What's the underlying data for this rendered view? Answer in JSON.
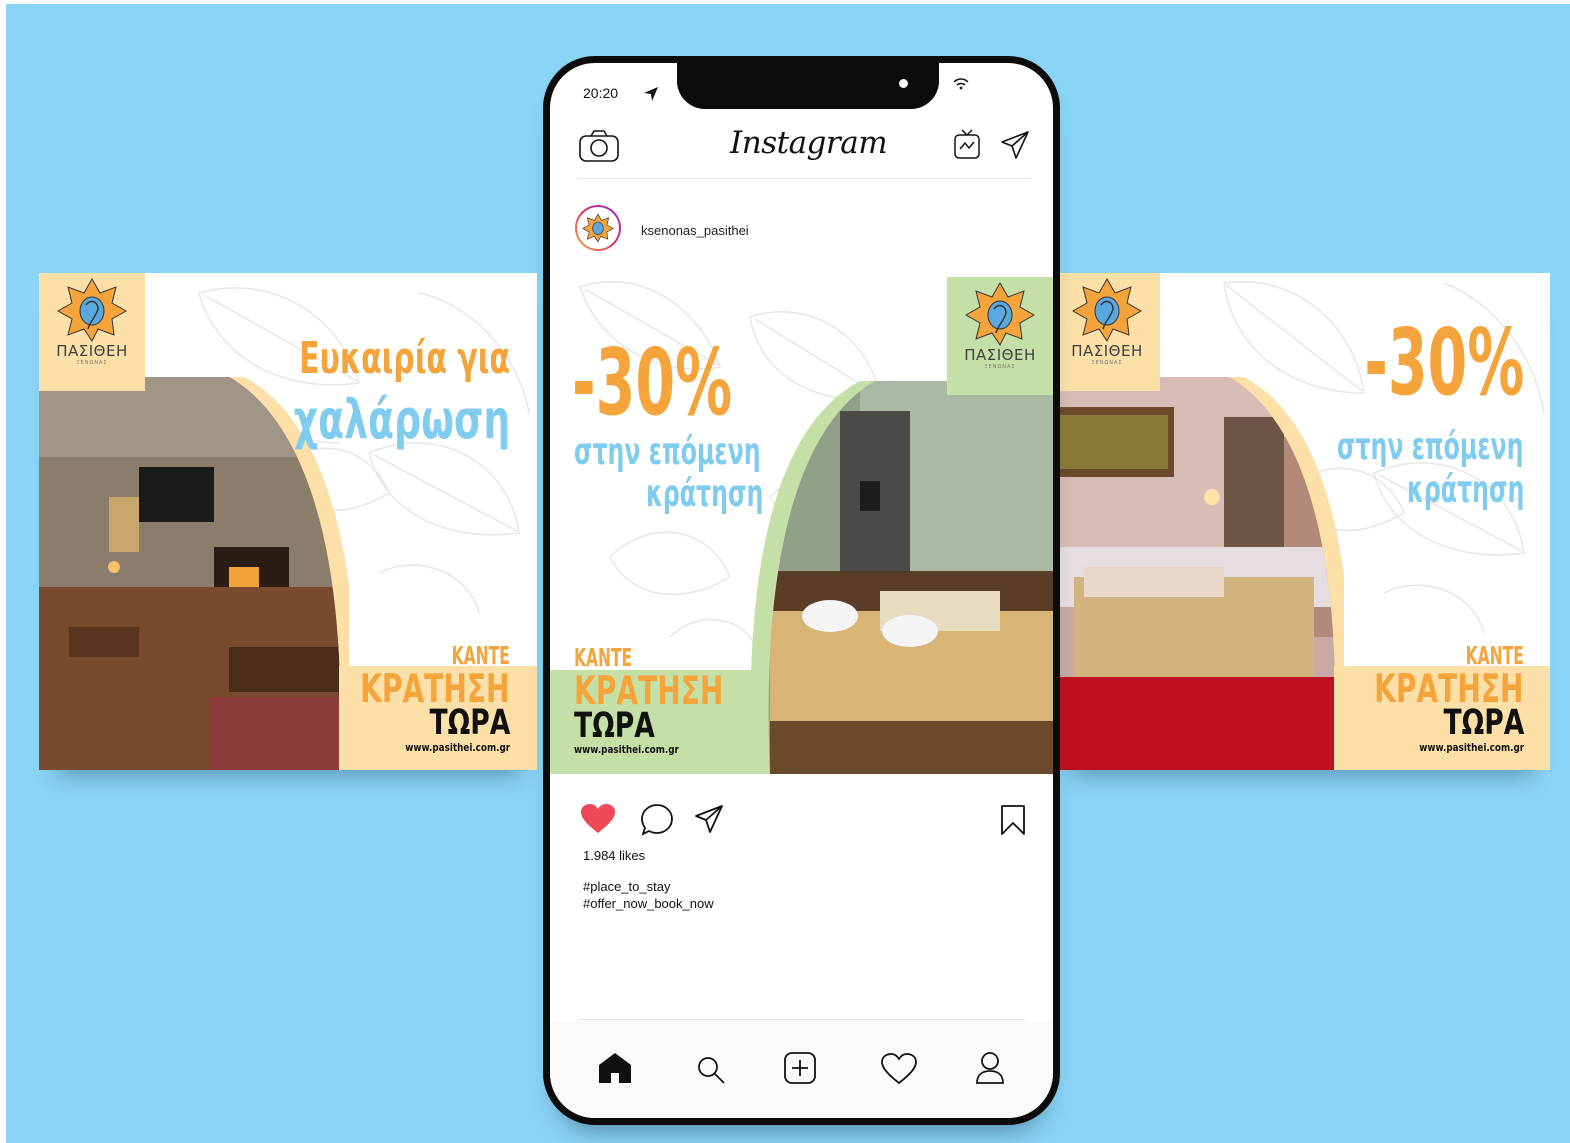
{
  "phone": {
    "status_time": "20:20",
    "app_title": "Instagram",
    "post": {
      "username": "ksenonas_pasithei",
      "likes": "1.984 likes",
      "hashtags": [
        "#place_to_stay",
        "#offer_now_book_now"
      ]
    },
    "icons": {
      "header": [
        "camera-icon",
        "igtv-icon",
        "direct-message-icon"
      ],
      "actions": [
        "heart-filled-icon",
        "comment-icon",
        "share-icon",
        "bookmark-icon"
      ],
      "tabs": [
        "home-icon",
        "search-icon",
        "new-post-icon",
        "activity-heart-icon",
        "profile-icon"
      ]
    }
  },
  "brand": {
    "logo_name": "ΠΑΣΙΘΕΗ",
    "logo_sub": "ΞΕΝΩΝΑΣ",
    "cta_line1": "ΚΑΝΤΕ",
    "cta_line2": "ΚΡΑΤΗΣΗ",
    "cta_line3": "ΤΩΡΑ",
    "website": "www.pasithei.com.gr"
  },
  "ads": {
    "left": {
      "headline_1": "Ευκαιρία για",
      "headline_2": "χαλάρωση"
    },
    "center": {
      "discount": "-30%",
      "line_1": "στην επόμενη",
      "line_2": "κράτηση"
    },
    "right": {
      "discount": "-30%",
      "line_1": "στην επόμενη",
      "line_2": "κράτηση"
    }
  },
  "colors": {
    "background": "#8ad4f5",
    "orange": "#f4a43a",
    "blue": "#80ccef",
    "peach": "#fde0a8",
    "green": "#c5e0a6",
    "heart": "#ed4956"
  }
}
